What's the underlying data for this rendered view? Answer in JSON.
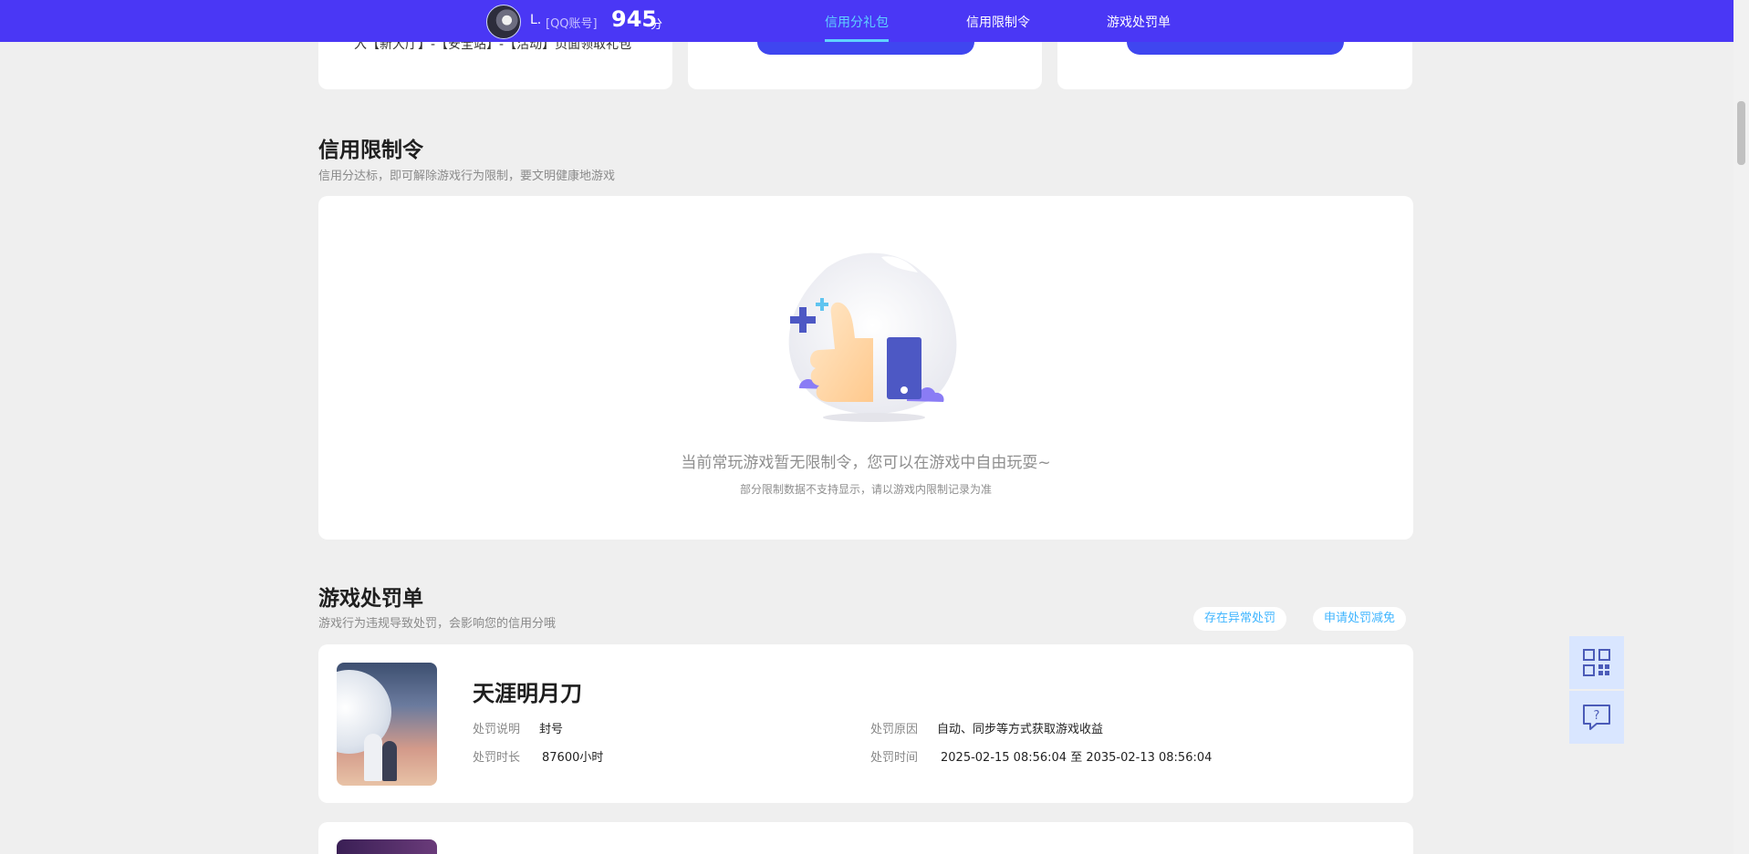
{
  "header": {
    "user_name": "L.",
    "account_type": "[QQ账号]",
    "score": "945",
    "score_unit": "分",
    "tabs": [
      {
        "label": "信用分礼包",
        "active": true
      },
      {
        "label": "信用限制令",
        "active": false
      },
      {
        "label": "游戏处罚单",
        "active": false
      }
    ],
    "accent": "#4a37f5",
    "active_tab_color": "#5fd3ff"
  },
  "gift_section": {
    "partial_text": "入【新大厅】-【安全站】-【活动】页面领取礼包"
  },
  "restriction_section": {
    "title": "信用限制令",
    "subtitle": "信用分达标，即可解除游戏行为限制，要文明健康地游戏",
    "empty_message": "当前常玩游戏暂无限制令，您可以在游戏中自由玩耍~",
    "empty_note": "部分限制数据不支持显示，请以游戏内限制记录为准"
  },
  "penalty_section": {
    "title": "游戏处罚单",
    "subtitle": "游戏行为违规导致处罚，会影响您的信用分哦",
    "actions": [
      "存在异常处罚",
      "申请处罚减免"
    ],
    "records": [
      {
        "game": "天涯明月刀",
        "desc_label": "处罚说明",
        "desc_value": "封号",
        "duration_label": "处罚时长",
        "duration_value": "87600小时",
        "reason_label": "处罚原因",
        "reason_value": "自动、同步等方式获取游戏收益",
        "time_label": "处罚时间",
        "time_value": "2025-02-15 08:56:04 至 2035-02-13 08:56:04"
      }
    ]
  },
  "floating": {
    "icons": [
      "qr-code-icon",
      "help-chat-icon"
    ]
  }
}
